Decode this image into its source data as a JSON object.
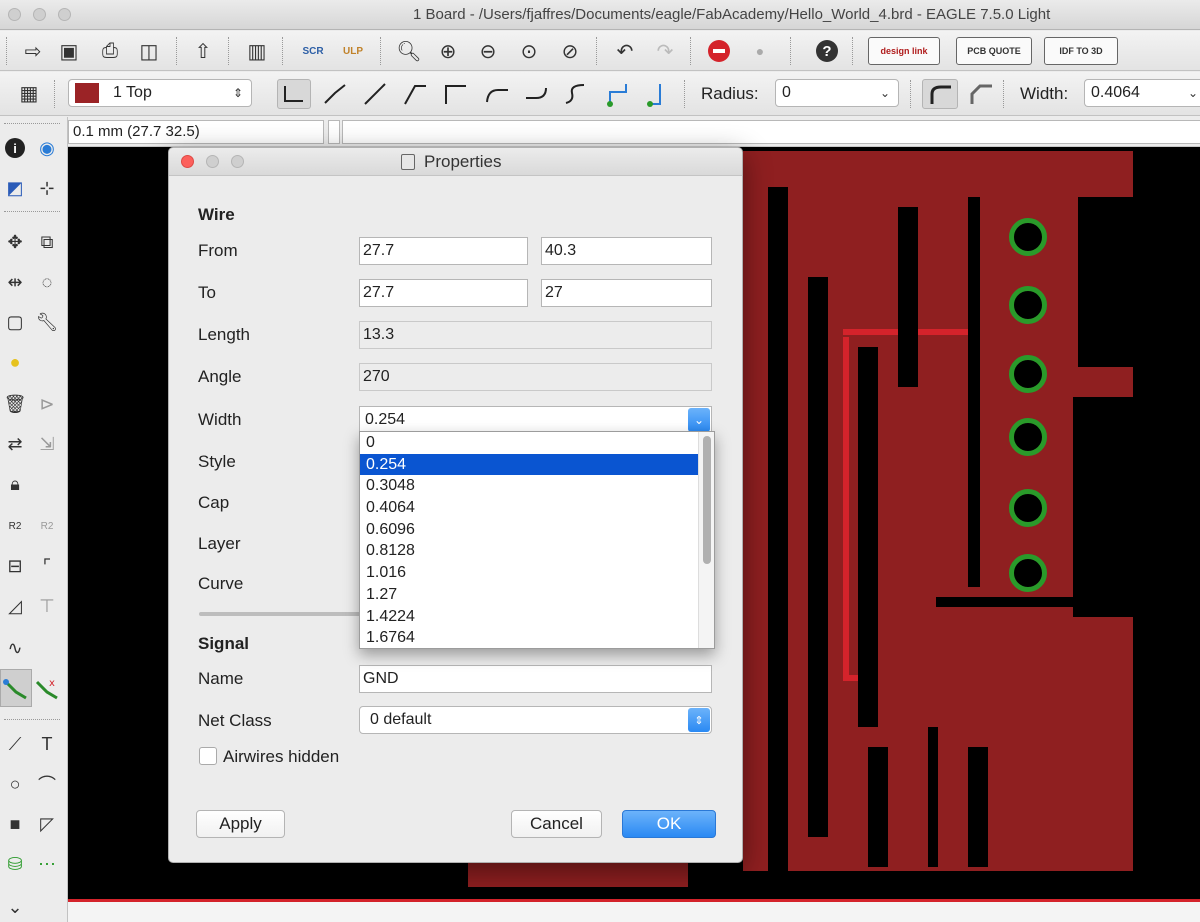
{
  "window": {
    "title": "1 Board - /Users/fjaffres/Documents/eagle/FabAcademy/Hello_World_4.brd - EAGLE 7.5.0 Light"
  },
  "toolbar1": {
    "icons": [
      "open-icon",
      "save-icon",
      "print-icon",
      "cam-icon",
      "export-icon",
      "layer-settings-icon",
      "script-icon",
      "ulp-icon",
      "zoom-fit-icon",
      "zoom-in-icon",
      "zoom-out-icon",
      "zoom-redraw-icon",
      "zoom-select-icon",
      "undo-icon",
      "redo-icon",
      "stop-icon",
      "go-icon",
      "help-icon"
    ],
    "designlink": "design link",
    "pcbquote": "PCB QUOTE",
    "idf": "IDF TO 3D"
  },
  "toolbar2": {
    "layer_label": "1 Top",
    "layer_color": "#9b2326",
    "radius_label": "Radius:",
    "radius_value": "0",
    "width_label": "Width:",
    "width_value": "0.4064"
  },
  "coordbar": {
    "coordinate": "0.1 mm (27.7 32.5)"
  },
  "dialog": {
    "title": "Properties",
    "section_wire": "Wire",
    "from_label": "From",
    "from_x": "27.7",
    "from_y": "40.3",
    "to_label": "To",
    "to_x": "27.7",
    "to_y": "27",
    "length_label": "Length",
    "length_value": "13.3",
    "angle_label": "Angle",
    "angle_value": "270",
    "width_label": "Width",
    "width_value": "0.254",
    "style_label": "Style",
    "cap_label": "Cap",
    "layer_label": "Layer",
    "curve_label": "Curve",
    "section_signal": "Signal",
    "name_label": "Name",
    "name_value": "GND",
    "netclass_label": "Net Class",
    "netclass_value": "0 default",
    "airwires_label": "Airwires hidden",
    "airwires_checked": false,
    "apply": "Apply",
    "cancel": "Cancel",
    "ok": "OK",
    "width_options": [
      "0",
      "0.254",
      "0.3048",
      "0.4064",
      "0.6096",
      "0.8128",
      "1.016",
      "1.27",
      "1.4224",
      "1.6764"
    ],
    "width_selected": "0.254"
  },
  "colors": {
    "copper": "#8f1f20",
    "pad": "#2a9a2a",
    "canvas_bg": "#000000",
    "selection": "#0a55d1",
    "accent_button": "#2a89f3"
  }
}
